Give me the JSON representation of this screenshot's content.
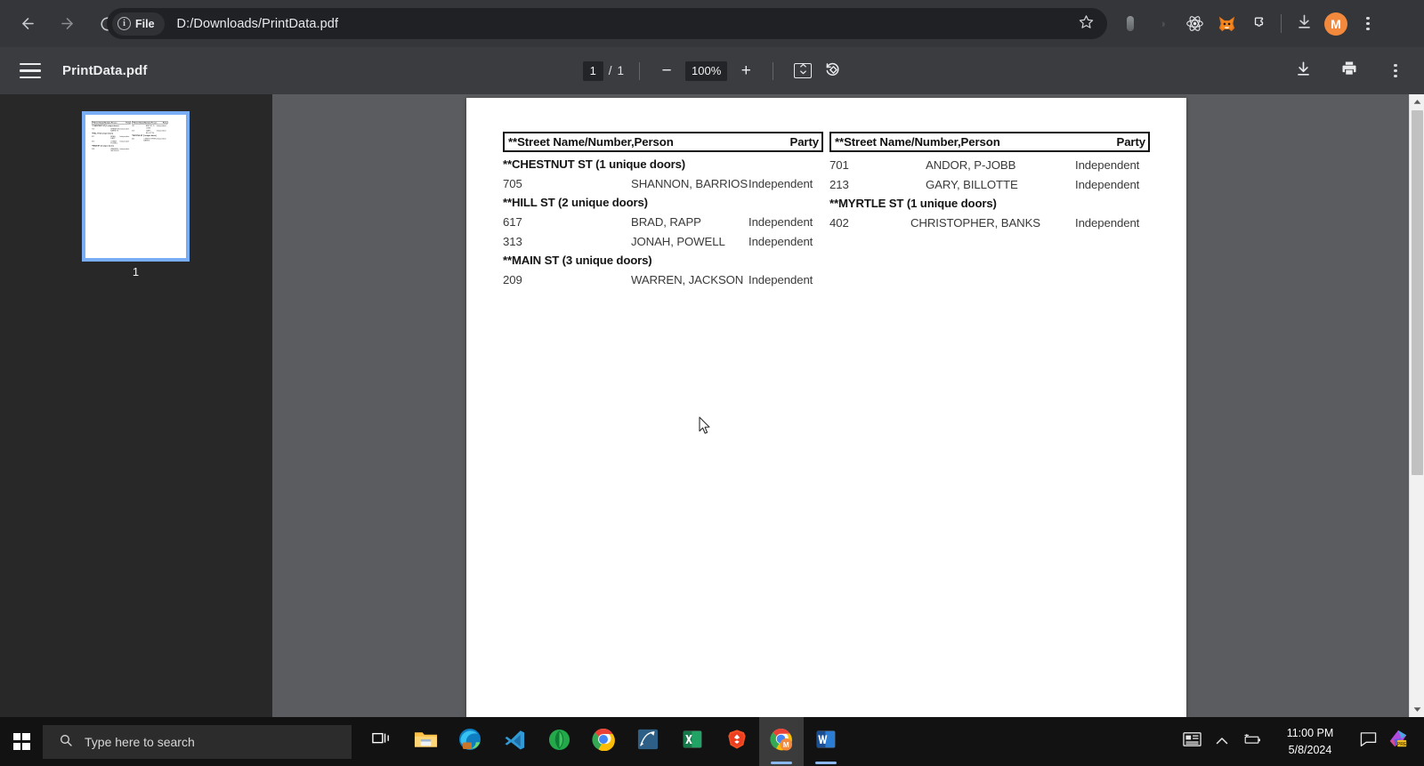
{
  "browser": {
    "back_icon": "back-arrow-icon",
    "forward_icon": "forward-arrow-icon",
    "reload_icon": "reload-icon",
    "chip_label": "File",
    "url": "D:/Downloads/PrintData.pdf",
    "bookmark_icon": "star-icon",
    "extensions": [
      {
        "name": "pill-extension-icon",
        "label": ""
      },
      {
        "name": "faint-extension-icon",
        "label": ""
      },
      {
        "name": "react-atom-extension-icon",
        "label": ""
      },
      {
        "name": "metamask-fox-extension-icon",
        "label": ""
      },
      {
        "name": "extensions-puzzle-icon",
        "label": ""
      }
    ],
    "download_icon": "download-icon",
    "avatar_label": "M",
    "menu_icon": "three-dot-menu-icon",
    "accent_avatar_color": "#f2893c"
  },
  "pdf_toolbar": {
    "sidebar_toggle_icon": "hamburger-menu-icon",
    "title": "PrintData.pdf",
    "current_page": "1",
    "page_separator": "/",
    "total_pages": "1",
    "zoom_out_label": "−",
    "zoom_level": "100%",
    "zoom_in_label": "+",
    "fit_page_icon": "fit-to-page-icon",
    "rotate_icon": "rotate-counterclockwise-icon",
    "download_icon": "download-icon",
    "print_icon": "print-icon",
    "more_icon": "more-options-icon"
  },
  "thumbnails": {
    "pages": [
      {
        "label": "1",
        "selected": true
      }
    ],
    "selection_color": "#79aef7"
  },
  "document": {
    "columns": [
      {
        "header": {
          "left": "**Street Name/Number,Person",
          "right": "Party"
        },
        "blocks": [
          {
            "type": "street",
            "title": "**CHESTNUT ST (1 unique doors)",
            "rows": [
              {
                "number": "705",
                "person": "SHANNON, BARRIOS",
                "party": "Independent",
                "indent": "indentB"
              }
            ]
          },
          {
            "type": "street",
            "title": "**HILL ST (2 unique doors)",
            "rows": [
              {
                "number": "617",
                "person": "BRAD, RAPP",
                "party": "Independent",
                "indent": "indentB"
              },
              {
                "number": "313",
                "person": "JONAH, POWELL",
                "party": "Independent",
                "indent": "indentB"
              }
            ]
          },
          {
            "type": "street",
            "title": "**MAIN ST (3 unique doors)",
            "rows": [
              {
                "number": "209",
                "person": "WARREN, JACKSON",
                "party": "Independent",
                "indent": "indentB"
              }
            ]
          }
        ]
      },
      {
        "header": {
          "left": "**Street Name/Number,Person",
          "right": "Party"
        },
        "blocks": [
          {
            "type": "rows",
            "title": "",
            "rows": [
              {
                "number": "701",
                "person": "ANDOR, P-JOBB",
                "party": "Independent",
                "indent": "indentC"
              },
              {
                "number": "213",
                "person": "GARY, BILLOTTE",
                "party": "Independent",
                "indent": "indentC"
              }
            ]
          },
          {
            "type": "street",
            "title": "**MYRTLE ST (1 unique doors)",
            "rows": [
              {
                "number": "402",
                "person": "CHRISTOPHER, BANKS",
                "party": "Independent",
                "indent": "indentA"
              }
            ]
          }
        ]
      }
    ]
  },
  "taskbar": {
    "start_icon": "windows-start-icon",
    "search_icon": "search-icon",
    "search_placeholder": "Type here to search",
    "apps": [
      {
        "name": "task-view-icon",
        "label": ""
      },
      {
        "name": "file-explorer-icon",
        "label": ""
      },
      {
        "name": "microsoft-edge-icon",
        "label": ""
      },
      {
        "name": "visual-studio-code-icon",
        "label": ""
      },
      {
        "name": "mongodb-compass-icon",
        "label": ""
      },
      {
        "name": "google-chrome-icon",
        "label": ""
      },
      {
        "name": "blue-app-icon",
        "label": ""
      },
      {
        "name": "microsoft-excel-icon",
        "label": ""
      },
      {
        "name": "brave-browser-icon",
        "label": ""
      },
      {
        "name": "chrome-metamask-window-icon",
        "label": ""
      },
      {
        "name": "microsoft-word-icon",
        "label": ""
      }
    ],
    "tray": {
      "news_icon": "news-and-interests-icon",
      "chevron_icon": "show-hidden-icons-icon",
      "battery_icon": "battery-icon",
      "time": "11:00 PM",
      "date": "5/8/2024",
      "notifications_icon": "notifications-icon",
      "app_icon": "color-app-tray-icon"
    }
  }
}
